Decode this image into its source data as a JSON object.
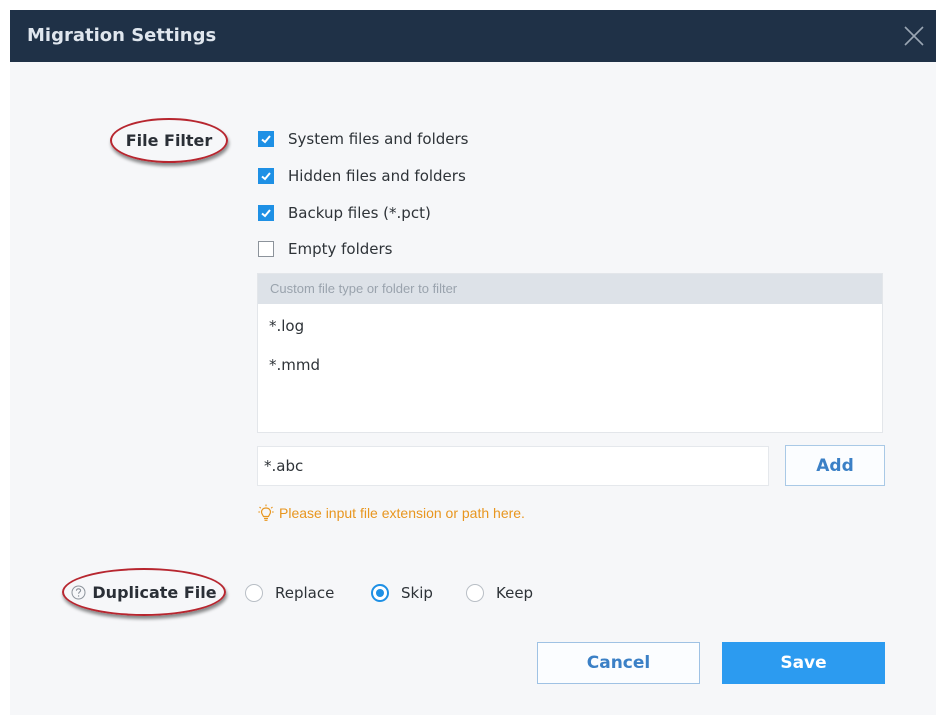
{
  "window": {
    "title": "Migration Settings"
  },
  "file_filter": {
    "label": "File Filter",
    "options": [
      {
        "label": "System files and folders",
        "checked": true
      },
      {
        "label": "Hidden files and folders",
        "checked": true
      },
      {
        "label": "Backup files (*.pct)",
        "checked": true
      },
      {
        "label": "Empty folders",
        "checked": false
      }
    ],
    "custom_list": {
      "header": "Custom file type or folder to filter",
      "items": [
        "*.log",
        "*.mmd"
      ]
    },
    "input_value": "*.abc",
    "add_label": "Add",
    "hint": "Please input file extension or path here."
  },
  "duplicate_file": {
    "label": "Duplicate File",
    "options": [
      {
        "label": "Replace",
        "selected": false
      },
      {
        "label": "Skip",
        "selected": true
      },
      {
        "label": "Keep",
        "selected": false
      }
    ]
  },
  "actions": {
    "cancel_label": "Cancel",
    "save_label": "Save"
  },
  "colors": {
    "titlebar": "#1f3147",
    "accent": "#1e90e5",
    "annotation": "#b7262f",
    "hint": "#e8961f"
  }
}
